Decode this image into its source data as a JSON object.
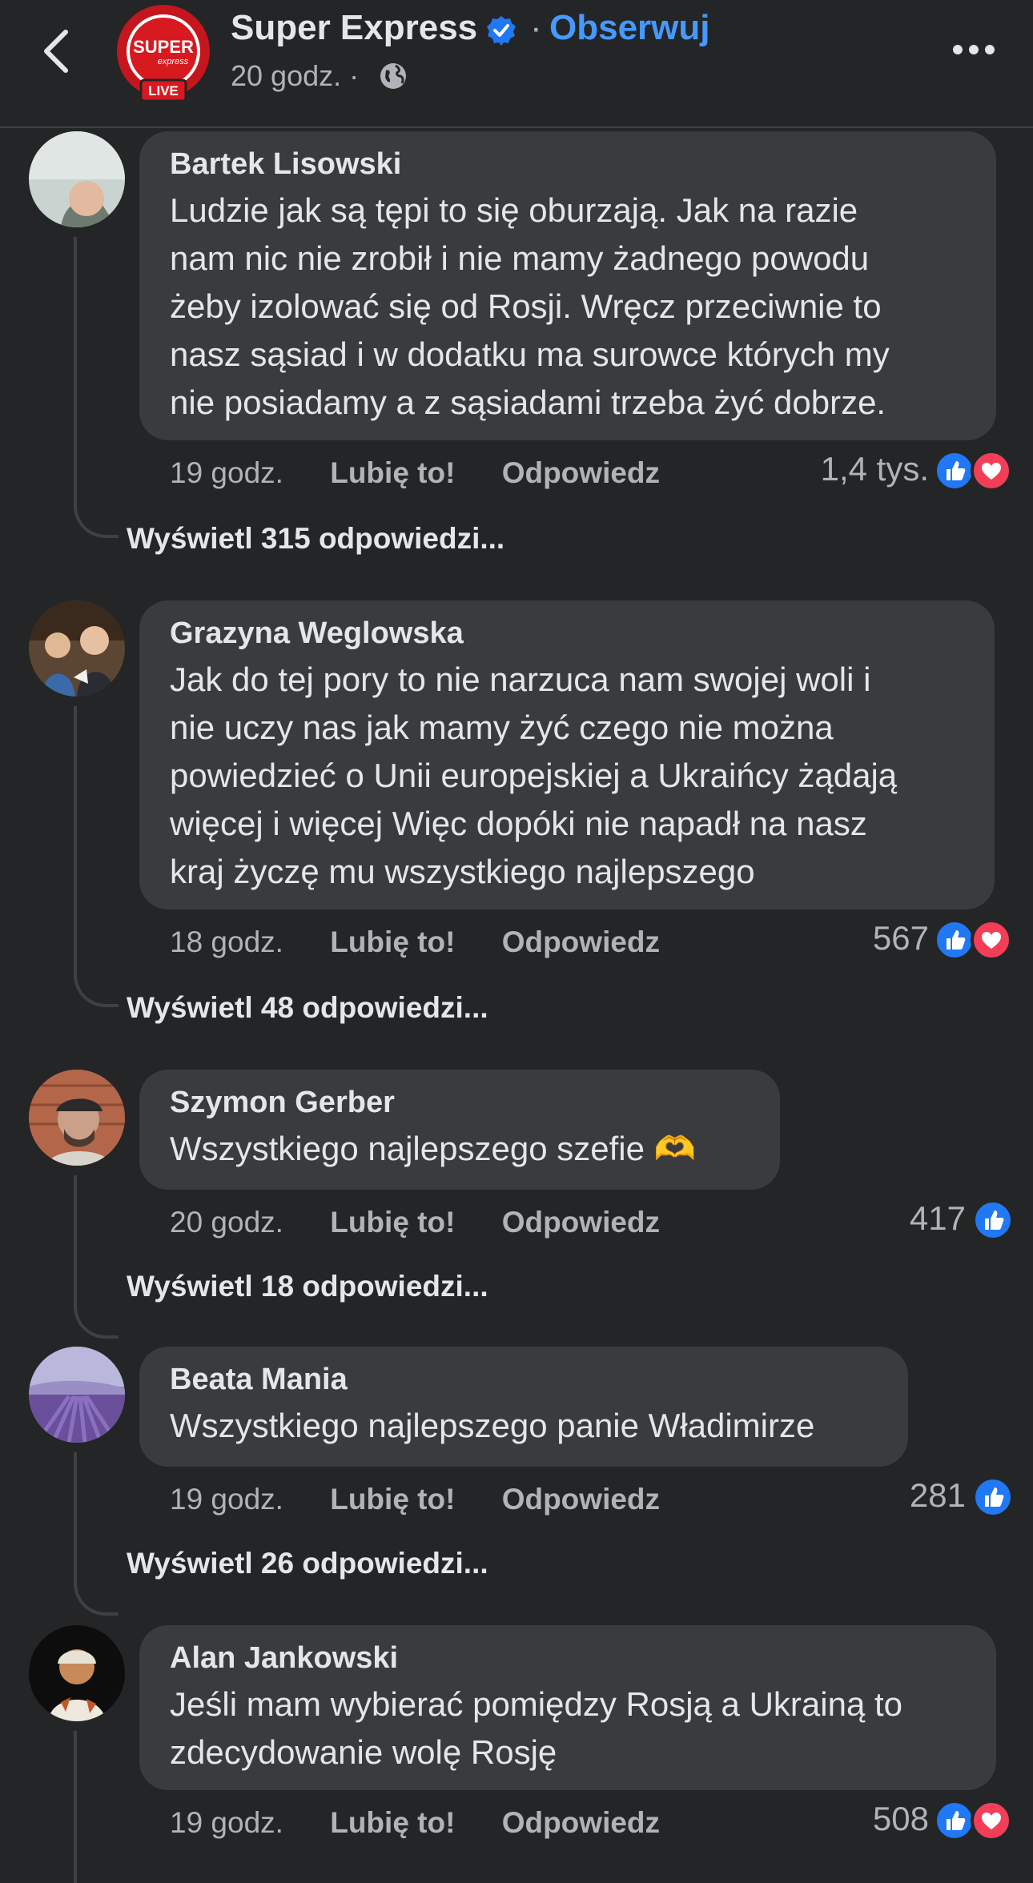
{
  "header": {
    "page_name": "Super Express",
    "follow_label": "Obserwuj",
    "separator": "·",
    "time": "20 godz. ·",
    "logo_text": "SUPER",
    "logo_sub": "express",
    "live_badge": "LIVE"
  },
  "actions": {
    "like": "Lubię to!",
    "reply": "Odpowiedz"
  },
  "colors": {
    "background": "#242526",
    "bubble": "#3a3b3c",
    "link": "#4599ff",
    "like": "#2078f4",
    "love": "#f33e58"
  },
  "comments": [
    {
      "author": "Bartek Lisowski",
      "text": "Ludzie jak są tępi to się oburzają. Jak na razie\nnam nic nie zrobił i nie mamy żadnego powodu\nżeby izolować się od Rosji. Wręcz przeciwnie to\nnasz sąsiad  i w dodatku ma surowce których my\nnie posiadamy a z sąsiadami trzeba żyć dobrze.",
      "time": "19 godz.",
      "reaction_count": "1,4 tys.",
      "reactions": [
        "like-icon",
        "love-icon"
      ],
      "view_replies": "Wyświetl 315 odpowiedzi..."
    },
    {
      "author": "Grazyna Weglowska",
      "text": "Jak do tej pory to nie narzuca nam swojej woli i\nnie uczy nas jak mamy żyć  czego nie można\npowiedzieć o Unii europejskiej a Ukraińcy żądają\nwięcej i więcej Więc dopóki nie napadł na nasz\nkraj życzę mu wszystkiego najlepszego",
      "time": "18 godz.",
      "reaction_count": "567",
      "reactions": [
        "like-icon",
        "love-icon"
      ],
      "view_replies": "Wyświetl 48 odpowiedzi..."
    },
    {
      "author": "Szymon Gerber",
      "text": "Wszystkiego najlepszego szefie 🫶",
      "time": "20 godz.",
      "reaction_count": "417",
      "reactions": [
        "like-icon"
      ],
      "view_replies": "Wyświetl 18 odpowiedzi..."
    },
    {
      "author": "Beata Mania",
      "text": "Wszystkiego najlepszego panie Władimirze",
      "time": "19 godz.",
      "reaction_count": "281",
      "reactions": [
        "like-icon"
      ],
      "view_replies": "Wyświetl 26 odpowiedzi..."
    },
    {
      "author": "Alan Jankowski",
      "text": "Jeśli mam wybierać pomiędzy Rosją a Ukrainą to\nzdecydowanie wolę Rosję",
      "time": "19 godz.",
      "reaction_count": "508",
      "reactions": [
        "like-icon",
        "love-icon"
      ]
    }
  ]
}
